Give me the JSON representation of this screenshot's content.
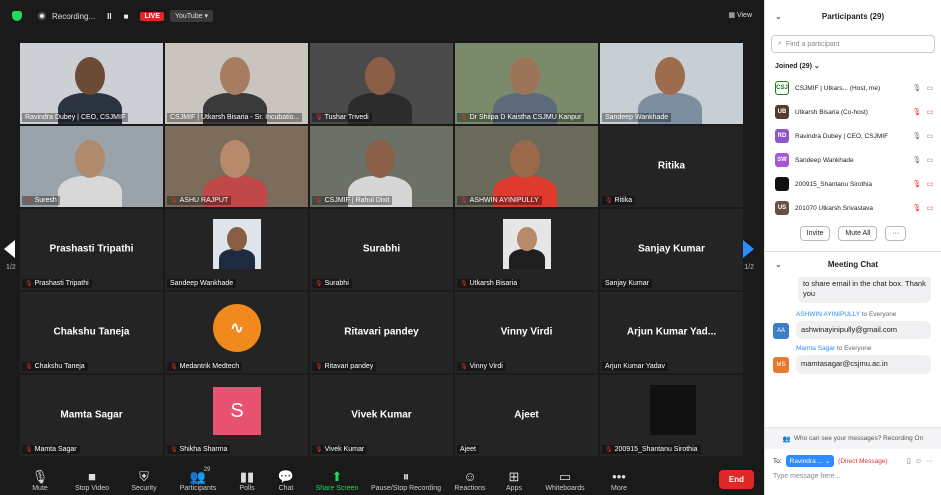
{
  "topbar": {
    "recording_label": "Recording...",
    "pause_symbol": "II",
    "stop_symbol": "■",
    "live_label": "LIVE",
    "youtube_label": "YouTube ▾",
    "view_label": "View"
  },
  "pagination": {
    "left": "1/2",
    "right": "1/2"
  },
  "tiles": [
    {
      "name": "Ravindra Dubey | CEO, CSJMIF",
      "muted": false,
      "video": true,
      "bg": "#ccd0d4",
      "skin": "#6b4a36",
      "shirt": "#2b3440"
    },
    {
      "name": "CSJMIF | Utkarsh Bisaria - Sr. Incubatio...",
      "muted": false,
      "video": true,
      "bg": "#c9c4bd",
      "skin": "#a77d62",
      "shirt": "#3a3a3a"
    },
    {
      "name": "Tushar Trivedi",
      "muted": true,
      "video": true,
      "bg": "#4a4a4a",
      "skin": "#8a5e44",
      "shirt": "#2c2c2c"
    },
    {
      "name": "Dr Shilpa D Kaistha CSJMU Kanpur",
      "muted": true,
      "video": true,
      "bg": "#7a8a6a",
      "skin": "#9c7558",
      "shirt": "#5c6a7a"
    },
    {
      "name": "Sandeep Wankhade",
      "muted": false,
      "video": true,
      "bg": "#c7cfd4",
      "skin": "#9c6c4c",
      "shirt": "#7d8ea0",
      "active": true
    },
    {
      "name": "Suresh",
      "muted": true,
      "video": true,
      "bg": "#9aa2aa",
      "skin": "#b08a6c",
      "shirt": "#d8d8d8"
    },
    {
      "name": "ASHU RAJPUT",
      "muted": true,
      "video": true,
      "bg": "#7c6c5c",
      "skin": "#b8896a",
      "shirt": "#c04848"
    },
    {
      "name": "CSJMIF | Rahul Dixit",
      "muted": true,
      "video": true,
      "bg": "#6c7066",
      "skin": "#8a6048",
      "shirt": "#d6d6d6"
    },
    {
      "name": "ASHWIN AYINIPULLY",
      "muted": true,
      "video": true,
      "bg": "#6a6a5a",
      "skin": "#9a6a4a",
      "shirt": "#e03a2e"
    },
    {
      "name": "Ritika",
      "muted": true,
      "video": false,
      "big": "Ritika"
    },
    {
      "name": "Prashasti Tripathi",
      "muted": true,
      "video": false,
      "big": "Prashasti Tripathi"
    },
    {
      "name": "Sandeep Wankhade",
      "muted": false,
      "video": true,
      "photo": true,
      "bg": "#dfe4ea",
      "skin": "#8a5e44",
      "shirt": "#1e2a40"
    },
    {
      "name": "Surabhi",
      "muted": true,
      "video": false,
      "big": "Surabhi"
    },
    {
      "name": "Utkarsh Bisaria",
      "muted": true,
      "video": true,
      "photo": true,
      "bg": "#e6e6e6",
      "skin": "#b8896a",
      "shirt": "#1e1e1e"
    },
    {
      "name": "Sanjay Kumar",
      "muted": false,
      "video": false,
      "big": "Sanjay Kumar"
    },
    {
      "name": "Chakshu Taneja",
      "muted": true,
      "video": false,
      "big": "Chakshu Taneja"
    },
    {
      "name": "Medantrik Medtech",
      "muted": true,
      "video": false,
      "logo": "orange"
    },
    {
      "name": "Ritavari pandey",
      "muted": true,
      "video": false,
      "big": "Ritavari pandey"
    },
    {
      "name": "Vinny Virdi",
      "muted": true,
      "video": false,
      "big": "Vinny Virdi"
    },
    {
      "name": "Arjun Kumar Yadav",
      "muted": false,
      "video": false,
      "big": "Arjun Kumar Yad..."
    },
    {
      "name": "Mamta Sagar",
      "muted": true,
      "video": false,
      "big": "Mamta Sagar"
    },
    {
      "name": "Shikha Sharma",
      "muted": true,
      "video": false,
      "logo": "pink",
      "logo_letter": "S"
    },
    {
      "name": "Vivek Kumar",
      "muted": true,
      "video": false,
      "big": "Vivek Kumar"
    },
    {
      "name": "Ajeet",
      "muted": false,
      "video": false,
      "big": "Ajeet"
    },
    {
      "name": "200915_Shantanu Sirothia",
      "muted": true,
      "video": false,
      "dark": true
    }
  ],
  "toolbar": [
    {
      "icon": "🎙",
      "label": "Mute",
      "caret": true
    },
    {
      "icon": "■",
      "label": "Stop Video",
      "caret": true
    },
    {
      "icon": "⛨",
      "label": "Security",
      "caret": false
    },
    {
      "icon": "👥",
      "label": "Participants",
      "caret": true,
      "count": "29"
    },
    {
      "icon": "▮▮",
      "label": "Polls",
      "caret": false
    },
    {
      "icon": "💬",
      "label": "Chat",
      "caret": true
    },
    {
      "icon": "⬆",
      "label": "Share Screen",
      "caret": true,
      "green": true
    },
    {
      "icon": "⏸",
      "label": "Pause/Stop Recording",
      "caret": false
    },
    {
      "icon": "☺",
      "label": "Reactions",
      "caret": true
    },
    {
      "icon": "⊞",
      "label": "Apps",
      "caret": false
    },
    {
      "icon": "▭",
      "label": "Whiteboards",
      "caret": true
    },
    {
      "icon": "•••",
      "label": "More",
      "caret": false
    }
  ],
  "end_label": "End",
  "panel": {
    "participants_title": "Participants (29)",
    "search_placeholder": "Find a participant",
    "joined_label": "Joined (29) ⌄",
    "participants": [
      {
        "initials": "CSJ",
        "color": "#ffffff",
        "text_color": "#1a7a1a",
        "name": "CSJMIF | Utkars... (Host, me)",
        "mic": "🎙",
        "cam": "▭",
        "mic_off": false,
        "cam_off": false
      },
      {
        "initials": "UB",
        "color": "#5a3a2a",
        "text_color": "#ffffff",
        "name": "Utkarsh Bisaria (Co-host)",
        "mic": "🎙",
        "cam": "▭",
        "mic_off": true,
        "cam_off": true
      },
      {
        "initials": "RD",
        "color": "#8e54c8",
        "text_color": "#ffffff",
        "name": "Ravindra Dubey | CEO, CSJMIF",
        "mic": "🎙",
        "cam": "▭",
        "mic_off": false,
        "cam_off": false
      },
      {
        "initials": "SW",
        "color": "#a855d8",
        "text_color": "#ffffff",
        "name": "Sandeep Wankhade",
        "mic": "🎙",
        "cam": "▭",
        "mic_off": false,
        "cam_off": false
      },
      {
        "initials": "",
        "color": "#111111",
        "text_color": "#ffffff",
        "name": "200915_Shantanu Sirothia",
        "mic": "🎙",
        "cam": "▭",
        "mic_off": true,
        "cam_off": true
      },
      {
        "initials": "US",
        "color": "#6a5040",
        "text_color": "#ffffff",
        "name": "201070 Utkarsh Srivastava",
        "mic": "🎙",
        "cam": "▭",
        "mic_off": true,
        "cam_off": true
      }
    ],
    "invite_label": "Invite",
    "mute_all_label": "Mute All",
    "more_label": "···",
    "chat_title": "Meeting Chat",
    "chat_top": "to share email in the chat box. Thank you",
    "messages": [
      {
        "initials": "AA",
        "color": "#3e7ec6",
        "from": "ASHWIN AYINIPULLY",
        "to": "to Everyone",
        "text": "ashwinayinipully@gmail.com"
      },
      {
        "initials": "MS",
        "color": "#e8792c",
        "from": "Mamta Sagar",
        "to": "to Everyone",
        "text": "mamtasagar@csjmu.ac.in"
      }
    ],
    "who_can_see": "Who can see your messages? Recording On",
    "to_label": "To:",
    "to_value": "Ravindra ... ⌄",
    "dm_label": "(Direct Message)",
    "type_placeholder": "Type message here..."
  }
}
